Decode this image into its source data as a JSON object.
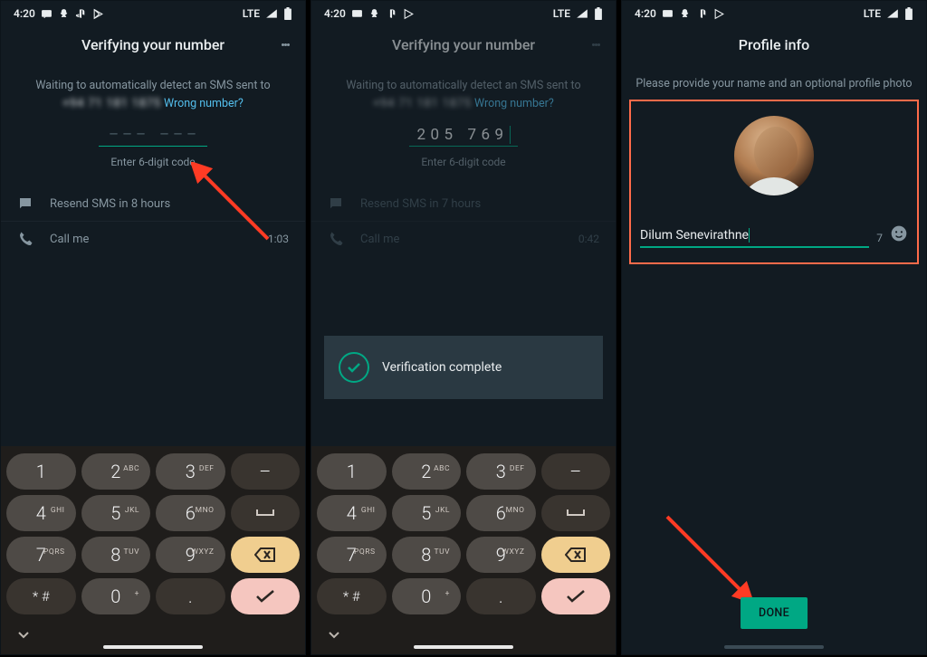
{
  "statusbar": {
    "time": "4:20",
    "net": "LTE"
  },
  "screen1": {
    "title": "Verifying your number",
    "waiting": "Waiting to automatically detect an SMS sent to",
    "number_masked": "+94 71 181 1875",
    "wrong": "Wrong number?",
    "code": [
      "",
      "",
      "",
      "",
      "",
      ""
    ],
    "enter_hint": "Enter 6-digit code",
    "resend": "Resend SMS in 8 hours",
    "callme": "Call me",
    "call_timer": "1:03"
  },
  "screen2": {
    "title": "Verifying your number",
    "waiting": "Waiting to automatically detect an SMS sent to",
    "number_masked": "+94 71 181 1875",
    "wrong": "Wrong number?",
    "code": [
      "2",
      "0",
      "5",
      "7",
      "6",
      "9"
    ],
    "enter_hint": "Enter 6-digit code",
    "resend": "Resend SMS in 7 hours",
    "callme": "Call me",
    "call_timer": "0:42",
    "toast": "Verification complete"
  },
  "screen3": {
    "title": "Profile info",
    "subtitle": "Please provide your name and an optional profile photo",
    "name_value": "Dilum Senevirathne",
    "name_remaining": "7",
    "done": "DONE"
  },
  "keypad": {
    "keys": [
      [
        "1",
        ""
      ],
      [
        "2",
        "ABC"
      ],
      [
        "3",
        "DEF"
      ],
      [
        "4",
        "GHI"
      ],
      [
        "5",
        "JKL"
      ],
      [
        "6",
        "MNO"
      ],
      [
        "7",
        "PQRS"
      ],
      [
        "8",
        "TUV"
      ],
      [
        "9",
        "WXYZ"
      ],
      [
        "* #",
        ""
      ],
      [
        "0",
        "+"
      ]
    ]
  }
}
